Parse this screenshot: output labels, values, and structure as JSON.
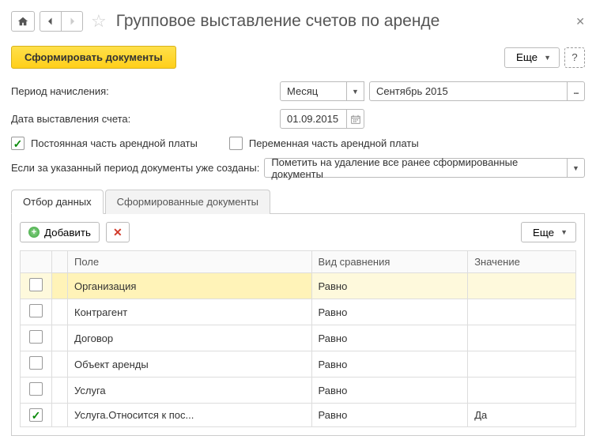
{
  "header": {
    "title": "Групповое выставление счетов по аренде"
  },
  "actions": {
    "primary": "Сформировать документы",
    "more": "Еще",
    "help": "?"
  },
  "period": {
    "label": "Период начисления:",
    "mode": "Месяц",
    "value": "Сентябрь 2015"
  },
  "date": {
    "label": "Дата выставления счета:",
    "value": "01.09.2015"
  },
  "parts": {
    "constant": {
      "label": "Постоянная часть арендной платы",
      "checked": true
    },
    "variable": {
      "label": "Переменная часть арендной платы",
      "checked": false
    }
  },
  "existing": {
    "label": "Если за указанный период документы уже созданы:",
    "value": "Пометить на удаление все ранее сформированные документы"
  },
  "tabs": {
    "filter": "Отбор данных",
    "docs": "Сформированные документы"
  },
  "toolbar": {
    "add": "Добавить",
    "more": "Еще"
  },
  "grid": {
    "columns": {
      "field": "Поле",
      "cmp": "Вид сравнения",
      "val": "Значение"
    },
    "rows": [
      {
        "checked": false,
        "field": "Организация",
        "cmp": "Равно",
        "val": "",
        "selected": true
      },
      {
        "checked": false,
        "field": "Контрагент",
        "cmp": "Равно",
        "val": ""
      },
      {
        "checked": false,
        "field": "Договор",
        "cmp": "Равно",
        "val": ""
      },
      {
        "checked": false,
        "field": "Объект аренды",
        "cmp": "Равно",
        "val": ""
      },
      {
        "checked": false,
        "field": "Услуга",
        "cmp": "Равно",
        "val": ""
      },
      {
        "checked": true,
        "field": "Услуга.Относится к пос...",
        "cmp": "Равно",
        "val": "Да"
      }
    ]
  }
}
